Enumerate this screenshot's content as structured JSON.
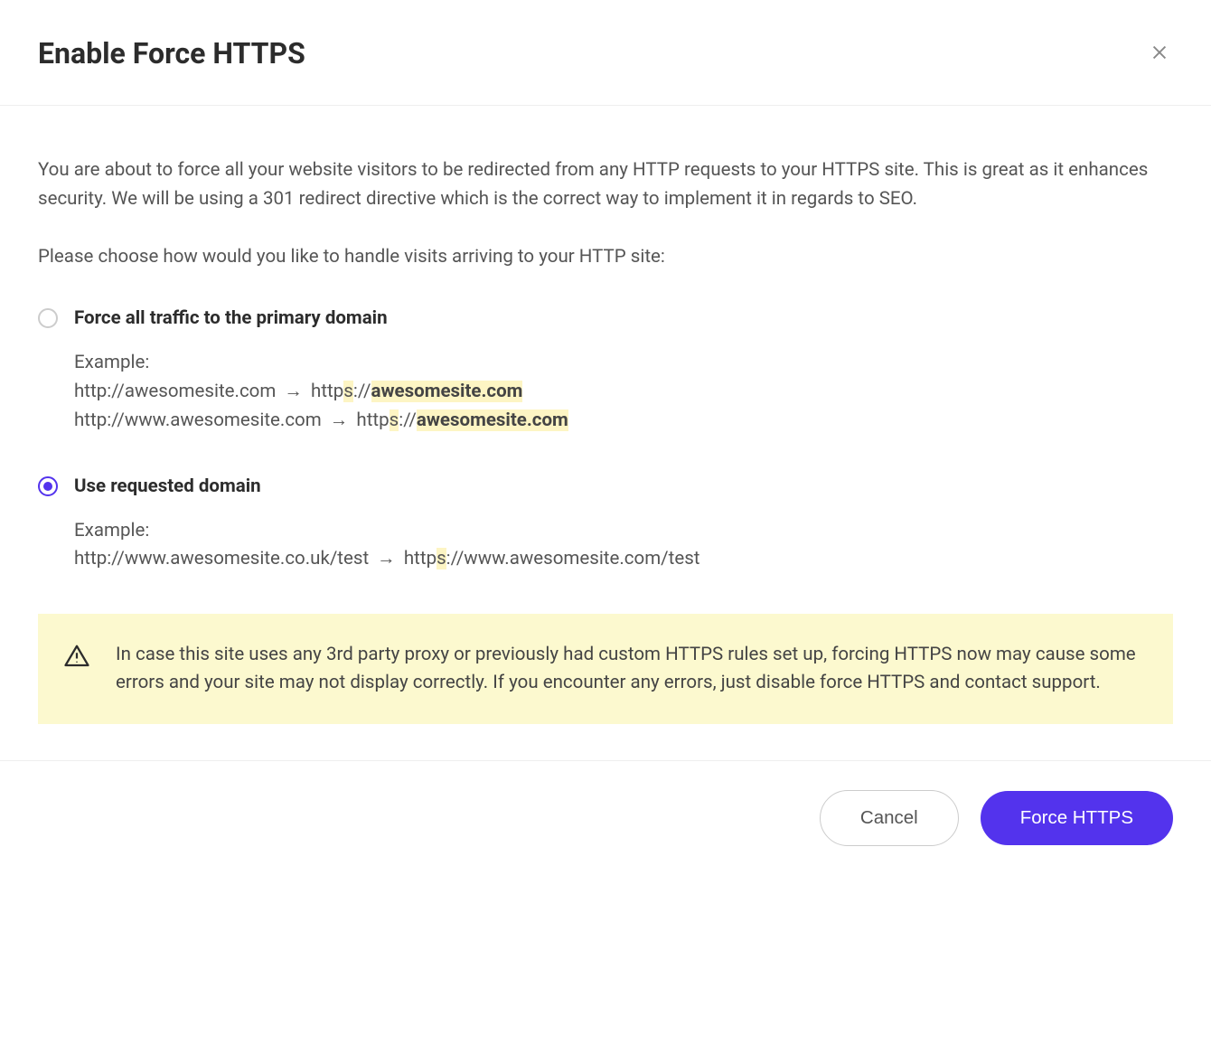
{
  "header": {
    "title": "Enable Force HTTPS"
  },
  "body": {
    "intro": "You are about to force all your website visitors to be redirected from any HTTP requests to your HTTPS site. This is great as it enhances security. We will be using a 301 redirect directive which is the correct way to implement it in regards to SEO.",
    "prompt": "Please choose how would you like to handle visits arriving to your HTTP site:",
    "options": [
      {
        "label": "Force all traffic to the primary domain",
        "selected": false,
        "example_label": "Example:",
        "examples": [
          {
            "from": "http://awesomesite.com",
            "to_prefix": "http",
            "to_s": "s",
            "to_sep": "://",
            "to_highlight": "awesomesite.com"
          },
          {
            "from": "http://www.awesomesite.com",
            "to_prefix": "http",
            "to_s": "s",
            "to_sep": "://",
            "to_highlight": "awesomesite.com"
          }
        ]
      },
      {
        "label": "Use requested domain",
        "selected": true,
        "example_label": "Example:",
        "examples": [
          {
            "from": "http://www.awesomesite.co.uk/test",
            "to_prefix": "http",
            "to_s": "s",
            "to_rest": "://www.awesomesite.com/test"
          }
        ]
      }
    ],
    "warning": "In case this site uses any 3rd party proxy or previously had custom HTTPS rules set up, forcing HTTPS now may cause some errors and your site may not display correctly. If you encounter any errors, just disable force HTTPS and contact support."
  },
  "footer": {
    "cancel_label": "Cancel",
    "submit_label": "Force HTTPS"
  }
}
